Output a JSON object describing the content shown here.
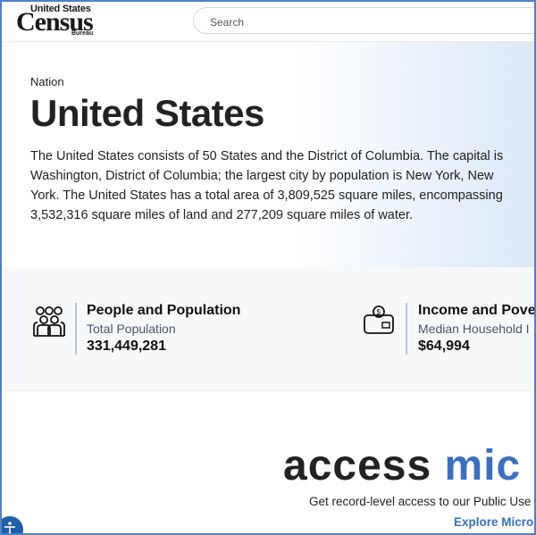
{
  "header": {
    "logo": {
      "line1": "United States",
      "line2": "Census",
      "line3": "Bureau"
    },
    "search": {
      "placeholder": "Search"
    }
  },
  "hero": {
    "breadcrumb": "Nation",
    "title": "United States",
    "description": "The United States consists of 50 States and the District of Columbia. The capital is Washington, District of Columbia; the largest city by population is New York, New York. The United States has a total area of 3,809,525 square miles, encompassing 3,532,316 square miles of land and 277,209 square miles of water."
  },
  "stats": [
    {
      "icon": "people-group-icon",
      "category": "People and Population",
      "label": "Total Population",
      "value": "331,449,281"
    },
    {
      "icon": "wallet-money-icon",
      "category": "Income and Pover",
      "label": "Median Household I",
      "value": "$64,994"
    }
  ],
  "promo": {
    "headline_part1": "access",
    "headline_part2": "mic",
    "subtext": "Get record-level access to our Public Use",
    "link": "Explore Microd"
  },
  "colors": {
    "accent": "#3b6fc2",
    "border": "#4f81c7"
  }
}
